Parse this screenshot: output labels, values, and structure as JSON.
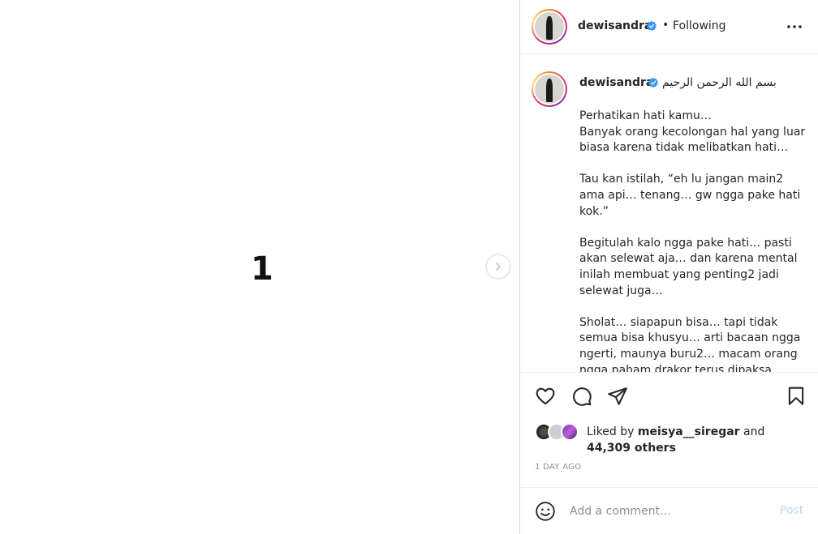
{
  "media": {
    "slide_number": "1",
    "next_icon": "chevron-right-icon"
  },
  "header": {
    "username": "dewisandra",
    "verified_icon": "verified-badge-icon",
    "separator": "•",
    "follow_status": "Following",
    "more_icon": "more-horizontal-icon"
  },
  "caption": {
    "username": "dewisandra",
    "opening": "بسم الله الرحمن الرحيم",
    "paragraphs": [
      "Perhatikan hati kamu…\nBanyak orang kecolongan hal yang luar biasa karena tidak melibatkan hati…",
      "Tau kan istilah, “eh lu jangan main2 ama api… tenang… gw ngga pake hati kok.”",
      "Begitulah kalo ngga pake hati… pasti akan selewat aja… dan karena mental inilah membuat yang penting2 jadi selewat juga…",
      "Sholat… siapapun bisa… tapi tidak semua bisa khusyu… arti bacaan ngga ngerti, maunya buru2… macam orang ngga paham drakor terus dipaksa nonton…"
    ]
  },
  "actions": {
    "like_icon": "heart-icon",
    "comment_icon": "comment-icon",
    "share_icon": "paper-plane-icon",
    "save_icon": "bookmark-icon"
  },
  "likes": {
    "prefix": "Liked by",
    "liker": "meisya__siregar",
    "conjunction": "and",
    "others": "44,309 others"
  },
  "timestamp": "1 DAY AGO",
  "comment": {
    "emoji_icon": "smiley-icon",
    "placeholder": "Add a comment…",
    "post_label": "Post"
  },
  "colors": {
    "verified": "#3897f0",
    "post_disabled": "#b3dbff",
    "border": "#dbdbdb",
    "muted": "#8e8e8e"
  }
}
